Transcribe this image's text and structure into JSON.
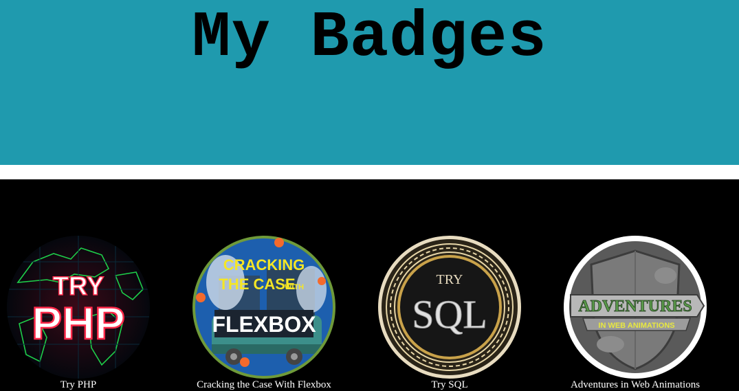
{
  "header": {
    "title": "My Badges"
  },
  "badges": [
    {
      "caption": "Try PHP",
      "art_line1": "TRY",
      "art_line2": "PHP",
      "accent": "#ff2a4a"
    },
    {
      "caption": "Cracking the Case With Flexbox",
      "art_line1": "CRACKING",
      "art_line2": "THE CASE",
      "art_line3": "WITH",
      "art_line4": "FLEXBOX",
      "accent": "#f5e625"
    },
    {
      "caption": "Try SQL",
      "art_line1": "TRY",
      "art_line2": "SQL",
      "accent": "#c9a24a"
    },
    {
      "caption": "Adventures in Web Animations",
      "art_line1": "ADVENTURES",
      "art_line2": "IN WEB ANIMATIONS",
      "accent": "#5a9a4a"
    }
  ]
}
